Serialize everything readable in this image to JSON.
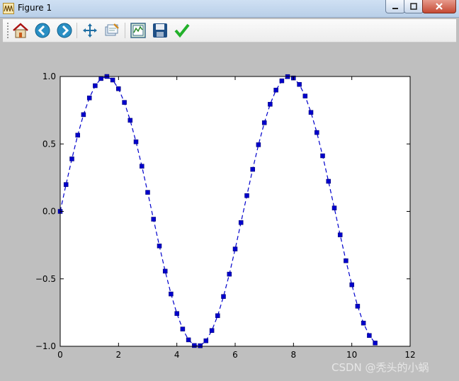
{
  "window": {
    "title": "Figure 1"
  },
  "toolbar": {
    "tools": [
      {
        "icon": "home-icon",
        "label": "Home"
      },
      {
        "icon": "back-icon",
        "label": "Back"
      },
      {
        "icon": "forward-icon",
        "label": "Forward"
      },
      {
        "icon": "pan-icon",
        "label": "Pan"
      },
      {
        "icon": "zoom-icon",
        "label": "Zoom"
      },
      {
        "icon": "subplots-icon",
        "label": "Configure subplots"
      },
      {
        "icon": "save-icon",
        "label": "Save"
      },
      {
        "icon": "edit-icon",
        "label": "Edit"
      }
    ]
  },
  "watermark": "CSDN @秃头的小蜗",
  "chart_data": {
    "type": "line",
    "title": "",
    "xlabel": "",
    "ylabel": "",
    "xlim": [
      0,
      12
    ],
    "ylim": [
      -1.0,
      1.0
    ],
    "xticks": [
      "0",
      "2",
      "4",
      "6",
      "8",
      "10",
      "12"
    ],
    "yticks": [
      "-1.0",
      "-0.5",
      "0.0",
      "0.5",
      "1.0"
    ],
    "grid": false,
    "line_style": "dashed",
    "marker": "square",
    "color": "#0000cc",
    "series": [
      {
        "x": [
          0.0,
          0.2,
          0.4,
          0.6,
          0.8,
          1.0,
          1.2,
          1.4,
          1.6,
          1.8,
          2.0,
          2.2,
          2.4,
          2.6,
          2.8,
          3.0,
          3.2,
          3.4,
          3.6,
          3.8,
          4.0,
          4.2,
          4.4,
          4.6,
          4.8,
          5.0,
          5.2,
          5.4,
          5.6,
          5.8,
          6.0,
          6.2,
          6.4,
          6.6,
          6.8,
          7.0,
          7.2,
          7.4,
          7.6,
          7.8,
          8.0,
          8.2,
          8.4,
          8.6,
          8.8,
          9.0,
          9.2,
          9.4,
          9.6,
          9.8,
          10.0,
          10.2,
          10.4,
          10.6,
          10.8
        ],
        "y": [
          0.0,
          0.199,
          0.389,
          0.565,
          0.717,
          0.841,
          0.932,
          0.985,
          1.0,
          0.974,
          0.909,
          0.808,
          0.675,
          0.516,
          0.335,
          0.141,
          -0.058,
          -0.256,
          -0.443,
          -0.612,
          -0.757,
          -0.872,
          -0.952,
          -0.994,
          -0.996,
          -0.959,
          -0.883,
          -0.773,
          -0.631,
          -0.465,
          -0.279,
          -0.083,
          0.117,
          0.312,
          0.494,
          0.657,
          0.794,
          0.899,
          0.968,
          0.999,
          0.989,
          0.941,
          0.855,
          0.734,
          0.585,
          0.412,
          0.223,
          0.025,
          -0.174,
          -0.366,
          -0.544,
          -0.703,
          -0.828,
          -0.92,
          -0.976
        ]
      }
    ]
  }
}
